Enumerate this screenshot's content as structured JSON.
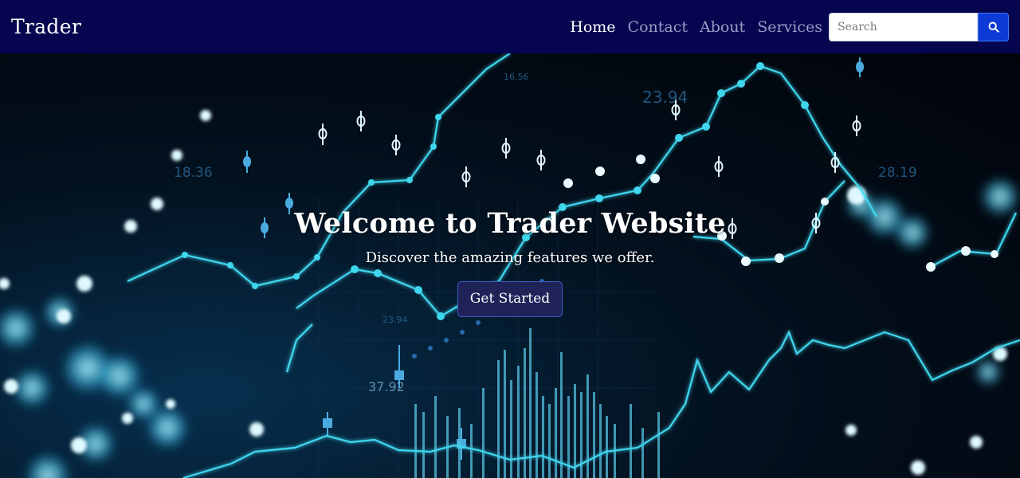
{
  "navbar": {
    "brand": "Trader",
    "links": [
      {
        "label": "Home",
        "active": true
      },
      {
        "label": "Contact",
        "active": false
      },
      {
        "label": "About",
        "active": false
      },
      {
        "label": "Services",
        "active": false
      }
    ],
    "search": {
      "placeholder": "Search",
      "value": "",
      "button_icon": "search-icon"
    }
  },
  "hero": {
    "title": "Welcome to Trader Website",
    "subtitle": "Discover the amazing features we offer.",
    "cta_label": "Get Started",
    "background_labels": [
      "23.94",
      "28.19",
      "18.36",
      "37.92",
      "23.94",
      "16.56"
    ]
  },
  "colors": {
    "navbar_bg": "#050550",
    "nav_active": "#ffffff",
    "nav_inactive": "#9a9ac4",
    "search_button": "#0d3ad6",
    "cta_bg": "#1f2358",
    "chart_cyan": "#3fd6ee"
  }
}
